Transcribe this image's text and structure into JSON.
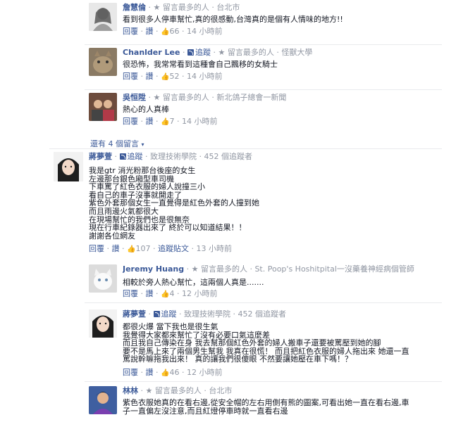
{
  "comments": [
    {
      "name": "詹慧倫",
      "meta": "留言最多的人 · 台北市",
      "follow": "",
      "text": "看到很多人停車幫忙,真的很感動,台灣真的是個有人情味的地方!!",
      "reply": "回覆",
      "like": "讚",
      "likes": "66",
      "extra": "",
      "time": "14 小時前"
    },
    {
      "name": "Chanlder Lee",
      "follow": "追蹤",
      "meta": "留言最多的人 · 怪獸大學",
      "text": "很恐怖，我常常看到這種會自己飄移的女騎士",
      "reply": "回覆",
      "like": "讚",
      "likes": "52",
      "extra": "",
      "time": "14 小時前"
    },
    {
      "name": "吳恒陞",
      "follow": "",
      "meta": "留言最多的人 · 新北鴿子總會一新聞",
      "text": "熱心的人真棒",
      "reply": "回覆",
      "like": "讚",
      "likes": "7",
      "extra": "",
      "time": "14 小時前"
    }
  ],
  "more_replies": "還有 4 個留言",
  "main": {
    "name": "蔣夢萱",
    "follow": "追蹤",
    "meta": "致理技術學院 · 452 個追蹤者",
    "text": "我是gtr 消光粉那台後座的女生\n左邊那台銀色廂型車司機\n下車罵了紅色衣服的婦人說撞三小\n看自己的車子沒事就開走了\n紫色外套那個女生一直覺得是紅色外套的人撞到她\n而且雨邊火氣都很大\n在現場幫忙的我們也是很無奈\n現在行車紀錄器出來了 終於可以知道結果！！\n謝謝各位網友",
    "reply": "回覆",
    "like": "讚",
    "likes": "107",
    "extra": "追蹤貼文",
    "time": "13 小時前"
  },
  "replies": [
    {
      "name": "Jeremy Huang",
      "follow": "",
      "meta": "留言最多的人 · St. Poop's Hoshitpital一沒藥養神經病個管師",
      "text": "相較於旁人熱心幫忙，這兩個人真是.......",
      "reply": "回覆",
      "like": "讚",
      "likes": "4",
      "extra": "",
      "time": "12 小時前"
    },
    {
      "name": "蔣夢萱",
      "follow": "追蹤",
      "meta": "致理技術學院 · 452 個追蹤者",
      "text": "都很火爆 當下我也是很生氣\n我覺得大家都來幫忙了沒有必要口氣這麼差\n而且我自己傳染在身 我去幫那個紅色外套的婦人搬車子還要被罵壓到她的腳\n要不是馬上來了兩個男生幫我 我真在很慌！ 而且把紅色衣服的婦人拖出來 她還一直\n罵說幹嘛拖我出來！ 真的讓我們很傻眼 不然要讓她壓在車下嗎！？",
      "reply": "回覆",
      "like": "讚",
      "likes": "46",
      "extra": "",
      "time": "12 小時前"
    },
    {
      "name": "林林",
      "follow": "",
      "meta": "留言最多的人 · 台北市",
      "text": "紫色衣服她真的在看右邊,從安全帽的左右用側有熊的圖案,可看出她一直在看右邊,車\n子一直偏左沒注意,而且紅燈停車時就一直看右邊",
      "reply": "",
      "like": "",
      "likes": "",
      "extra": "",
      "time": ""
    }
  ],
  "icons": {
    "star": "star-icon",
    "rss": "rss-icon",
    "thumb": "thumbs-up-icon"
  },
  "colors": {
    "link": "#3b5998",
    "meta": "#9197a3",
    "text": "#141823"
  }
}
